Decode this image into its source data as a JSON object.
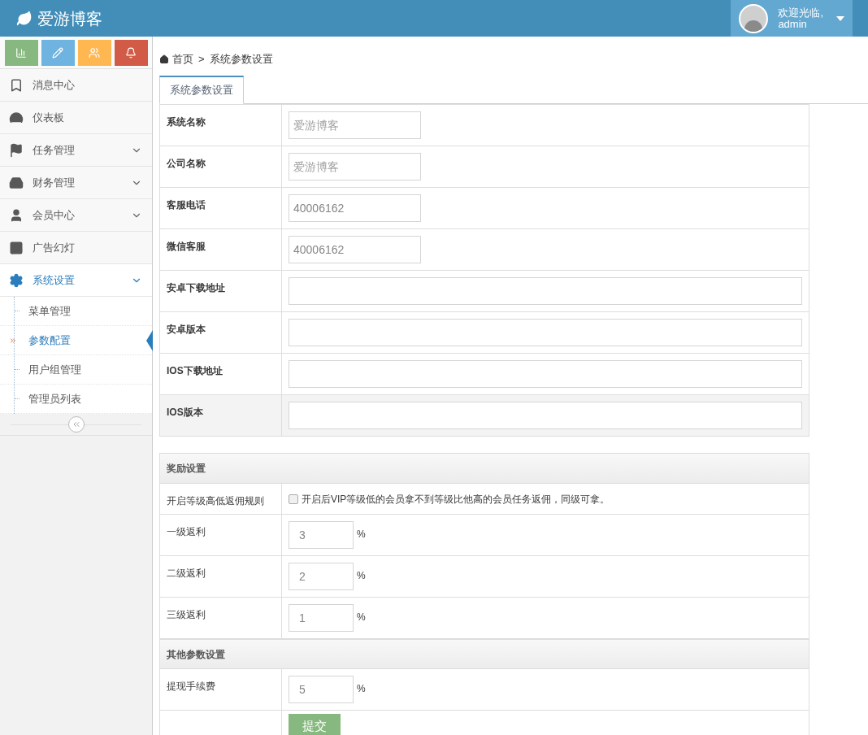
{
  "header": {
    "brand": "爱游博客",
    "greeting": "欢迎光临,",
    "username": "admin"
  },
  "shortcuts": [
    {
      "color": "#87b87f"
    },
    {
      "color": "#6fb3e0"
    },
    {
      "color": "#ffb752"
    },
    {
      "color": "#d15b47"
    }
  ],
  "sidebar": {
    "items": [
      {
        "label": "消息中心",
        "selected": false
      },
      {
        "label": "仪表板",
        "selected": false
      },
      {
        "label": "任务管理",
        "selected": false,
        "expanded": false
      },
      {
        "label": "财务管理",
        "selected": false,
        "expanded": false
      },
      {
        "label": "会员中心",
        "selected": false,
        "expanded": false
      },
      {
        "label": "广告幻灯",
        "selected": false
      },
      {
        "label": "系统设置",
        "selected": true,
        "expanded": true,
        "children": [
          {
            "label": "菜单管理",
            "selected": false
          },
          {
            "label": "参数配置",
            "selected": true
          },
          {
            "label": "用户组管理",
            "selected": false
          },
          {
            "label": "管理员列表",
            "selected": false
          }
        ]
      }
    ]
  },
  "breadcrumb": {
    "separator": ">",
    "items": [
      "首页",
      "系统参数设置"
    ]
  },
  "tabs": [
    {
      "label": "系统参数设置",
      "selected": true
    }
  ],
  "sections": [
    {
      "rows": [
        {
          "label": "系统名称",
          "kind": "short",
          "placeholder": "爱游博客",
          "highlighted": false
        },
        {
          "label": "公司名称",
          "kind": "short",
          "placeholder": "爱游博客",
          "highlighted": false
        },
        {
          "label": "客服电话",
          "kind": "short",
          "value": "40006162",
          "highlighted": false
        },
        {
          "label": "微信客服",
          "kind": "short",
          "value": "40006162",
          "highlighted": false
        },
        {
          "label": "安卓下载地址",
          "kind": "long",
          "highlighted": false
        },
        {
          "label": "安卓版本",
          "kind": "long",
          "highlighted": false
        },
        {
          "label": "IOS下载地址",
          "kind": "long",
          "highlighted": false
        },
        {
          "label": "IOS版本",
          "kind": "long",
          "highlighted": true
        }
      ]
    },
    {
      "title": "奖励设置",
      "rows": [
        {
          "label": "开启等级高低返佣规则",
          "kind": "checkbox",
          "checked": false,
          "text": "开启后VIP等级低的会员拿不到等级比他高的会员任务返佣，同级可拿。"
        },
        {
          "label": "一级返利",
          "kind": "percent",
          "value": "3",
          "unit": "%"
        },
        {
          "label": "二级返利",
          "kind": "percent",
          "value": "2",
          "unit": "%"
        },
        {
          "label": "三级返利",
          "kind": "percent",
          "value": "1",
          "unit": "%"
        }
      ]
    },
    {
      "title": "其他参数设置",
      "rows": [
        {
          "label": "提现手续费",
          "kind": "percent",
          "value": "5",
          "unit": "%"
        },
        {
          "kind": "submit",
          "button": "提交"
        }
      ]
    }
  ]
}
